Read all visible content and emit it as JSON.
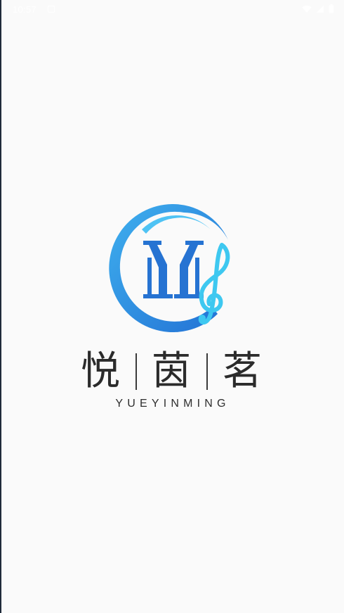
{
  "status_bar": {
    "time": "10:57",
    "icons": [
      "notification-icon",
      "wifi-icon",
      "signal-icon",
      "battery-icon"
    ]
  },
  "brand": {
    "name_chars": [
      "悦",
      "茵",
      "茗"
    ],
    "pinyin": "YUEYINMING",
    "logo_letters": "YM"
  },
  "colors": {
    "logo_blue": "#2a78d8",
    "logo_light_blue": "#3ec8f0",
    "text_dark": "#2b2b2b",
    "background": "#fafafa"
  }
}
